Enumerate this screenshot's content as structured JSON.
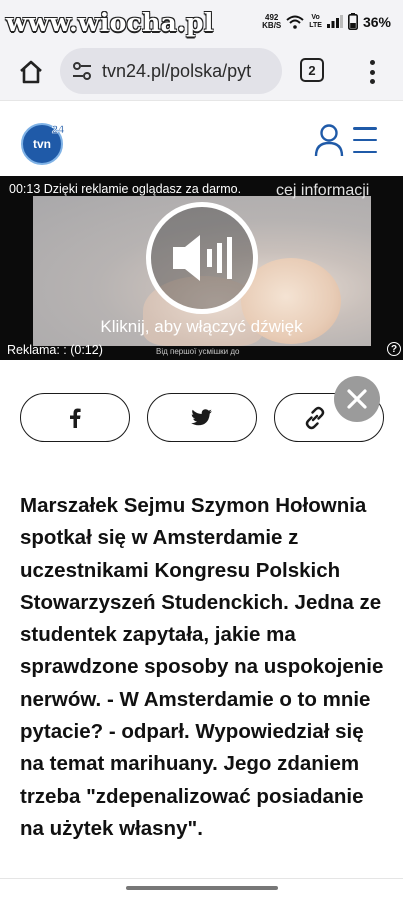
{
  "status_bar": {
    "watermark": "www.wiocha.pl",
    "net_speed_value": "492",
    "net_speed_unit": "KB/S",
    "volte_top": "Vo",
    "volte_bottom": "LTE",
    "battery_percent": "36%",
    "icons": [
      "wifi-icon",
      "signal-icon",
      "battery-icon"
    ]
  },
  "browser": {
    "url": "tvn24.pl/polska/pyt",
    "tab_count": "2",
    "icons": [
      "home-icon",
      "site-settings-icon",
      "overflow-menu-icon"
    ]
  },
  "site_header": {
    "logo_text": "tvn24",
    "icons": [
      "user-icon",
      "hamburger-menu-icon"
    ],
    "accent_color": "#1f5aa8"
  },
  "video_ad": {
    "counter_text": "00:13 Dzięki reklamie oglądasz za darmo.",
    "more_info_text": "cej informacji",
    "sound_caption": "Kliknij, aby włączyć dźwięk",
    "ad_label": "Reklama: : (0:12)",
    "small_text": "Від першої усмішки до",
    "help_symbol": "?"
  },
  "share": {
    "buttons": [
      "facebook-icon",
      "twitter-icon",
      "link-icon"
    ],
    "close_symbol": "✕"
  },
  "article": {
    "lead": "Marszałek Sejmu Szymon Hołownia spotkał się w Amsterdamie z uczestnikami Kongresu Polskich Stowarzyszeń Studenckich. Jedna ze studentek zapytała, jakie ma sprawdzone sposoby na uspokojenie nerwów. - W Amsterdamie o to mnie pytacie? - odparł. Wypowiedział się na temat marihuany. Jego zdaniem trzeba \"zdepenalizować posiadanie na użytek własny\"."
  }
}
